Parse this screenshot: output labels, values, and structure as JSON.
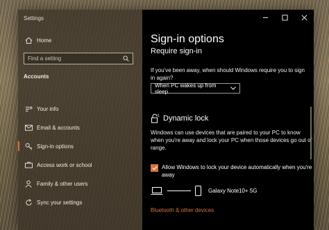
{
  "window": {
    "title": "Settings"
  },
  "sidebar": {
    "home_label": "Home",
    "search_placeholder": "Find a setting",
    "section": "Accounts",
    "items": [
      {
        "label": "Your info",
        "icon": "person-card-icon"
      },
      {
        "label": "Email & accounts",
        "icon": "mail-icon"
      },
      {
        "label": "Sign-in options",
        "icon": "key-icon",
        "selected": true
      },
      {
        "label": "Access work or school",
        "icon": "briefcase-icon"
      },
      {
        "label": "Family & other users",
        "icon": "people-icon"
      },
      {
        "label": "Sync your settings",
        "icon": "sync-icon"
      }
    ]
  },
  "main": {
    "title": "Sign-in options",
    "require_heading": "Require sign-in",
    "require_question": "If you've been away, when should Windows require you to sign in again?",
    "require_dropdown_value": "When PC wakes up from sleep",
    "dynamic_lock_heading": "Dynamic lock",
    "dynamic_lock_description": "Windows can use devices that are paired to your PC to know when you're away and lock your PC when those devices go out of range.",
    "checkbox_label": "Allow Windows to lock your device automatically when you're away",
    "checkbox_checked": true,
    "paired_device": "Galaxy Note10+ 5G",
    "link_label": "Bluetooth & other devices"
  },
  "colors": {
    "accent": "#d4743a",
    "main_background": "#000000",
    "sidebar_background": "#3a3226"
  }
}
